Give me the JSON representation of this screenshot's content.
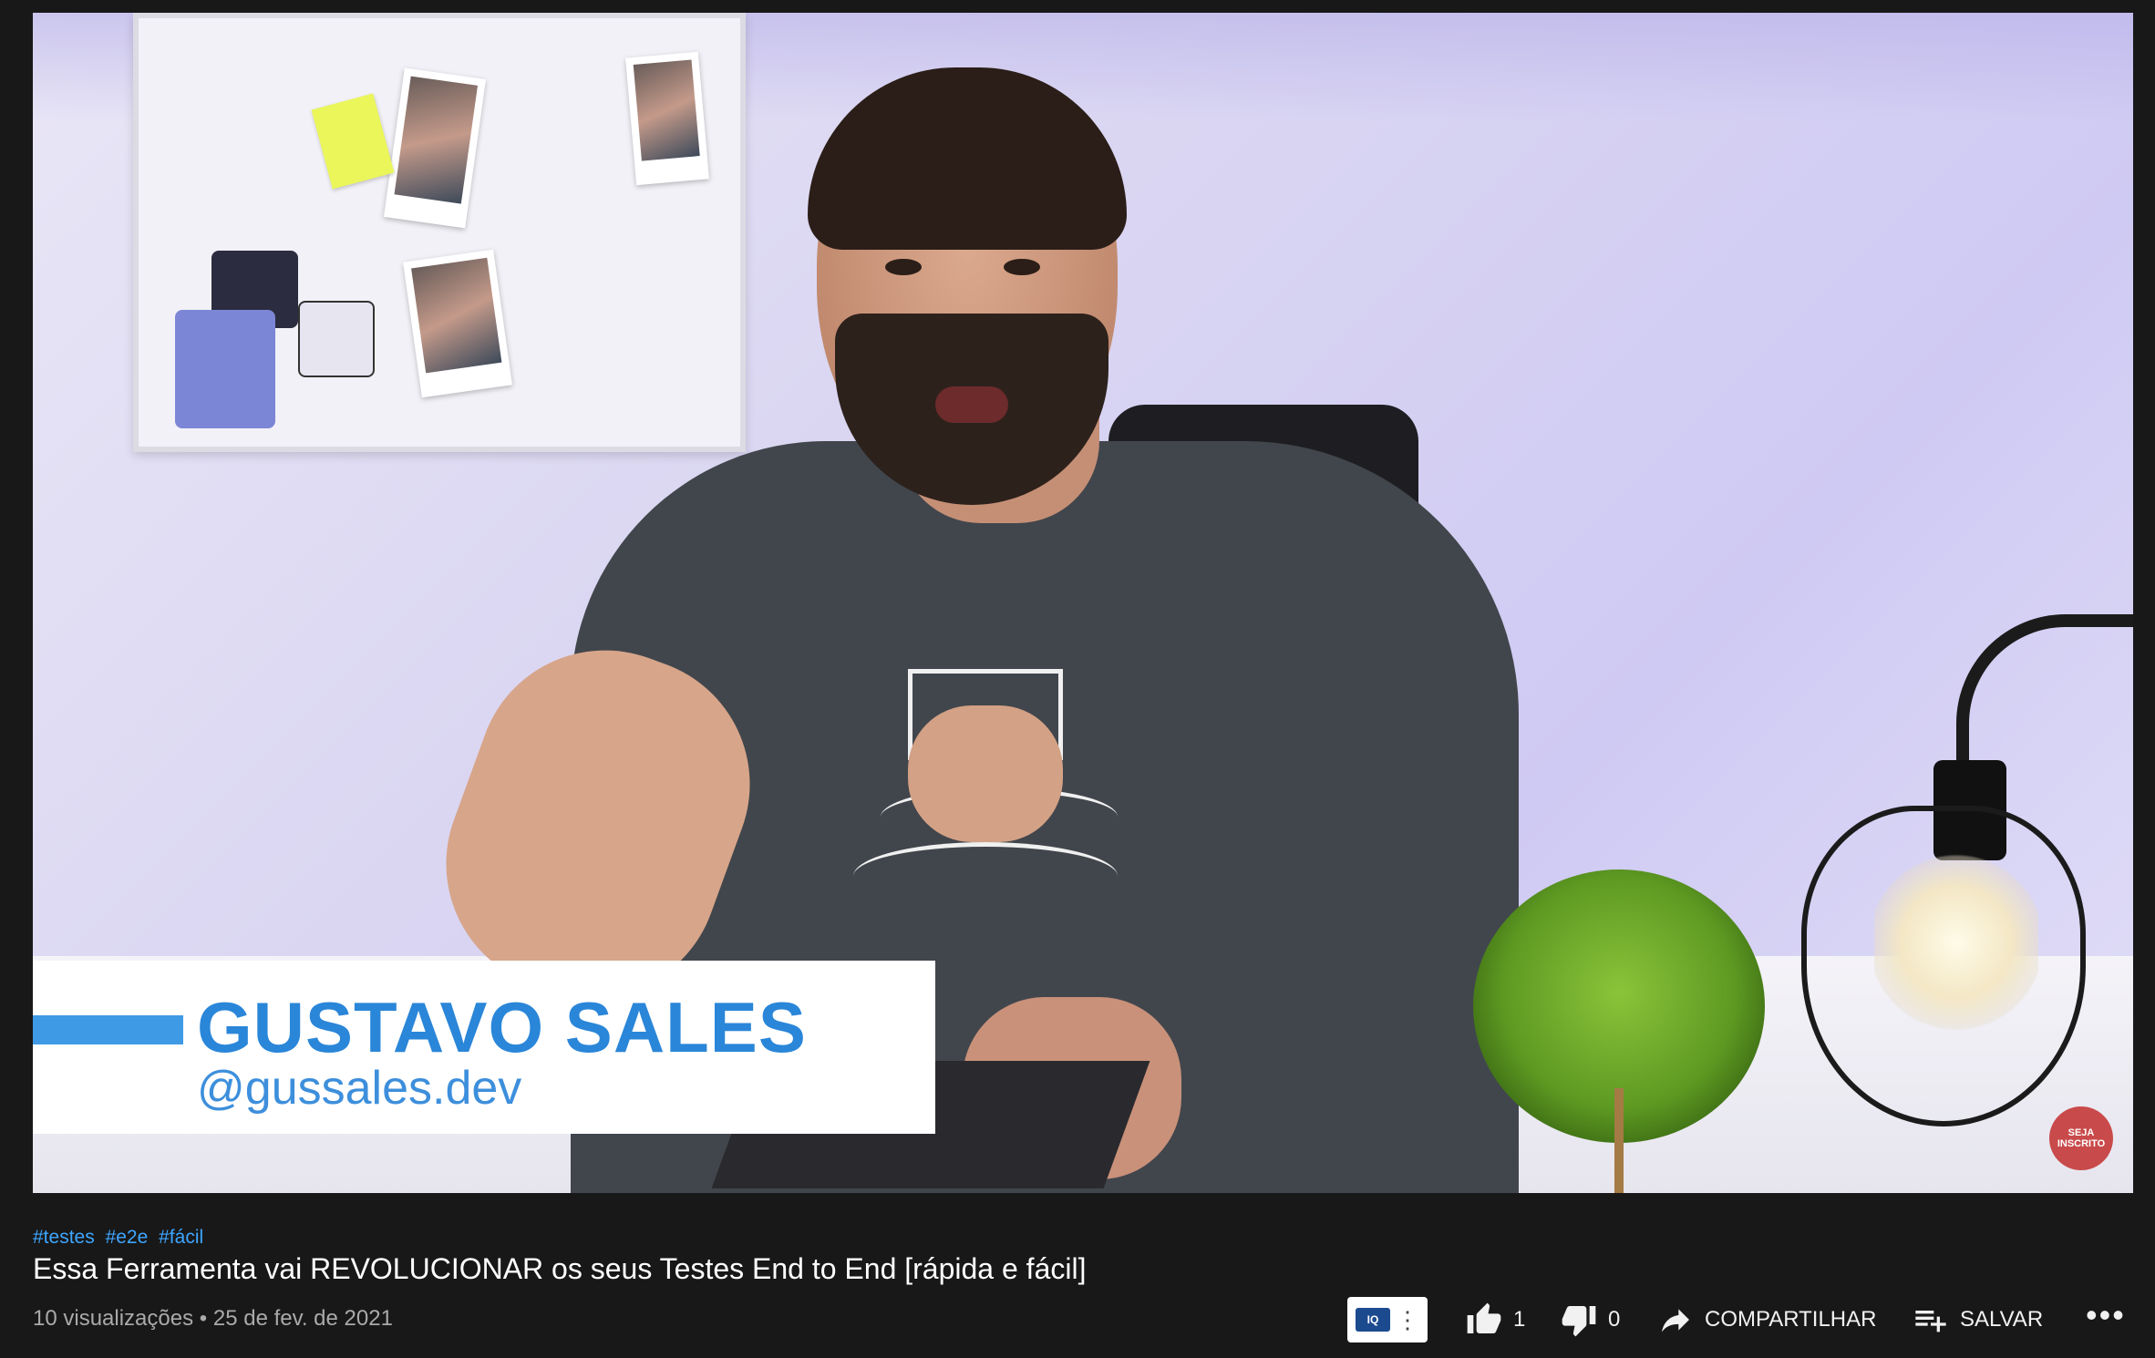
{
  "video": {
    "lower_third_name": "GUSTAVO SALES",
    "lower_third_handle": "@gussales.dev",
    "subscribe_badge": "SEJA INSCRITO"
  },
  "hashtags": [
    "#testes",
    "#e2e",
    "#fácil"
  ],
  "title": "Essa Ferramenta vai REVOLUCIONAR os seus Testes End to End [rápida e fácil]",
  "meta": {
    "views": "10 visualizações",
    "separator": "•",
    "date": "25 de fev. de 2021"
  },
  "actions": {
    "extension_label": "IQ",
    "like_count": "1",
    "dislike_count": "0",
    "share_label": "COMPARTILHAR",
    "save_label": "SALVAR"
  },
  "icons": {
    "like": "thumb-up-icon",
    "dislike": "thumb-down-icon",
    "share": "share-arrow-icon",
    "save": "playlist-add-icon",
    "more": "more-horizontal-icon"
  }
}
